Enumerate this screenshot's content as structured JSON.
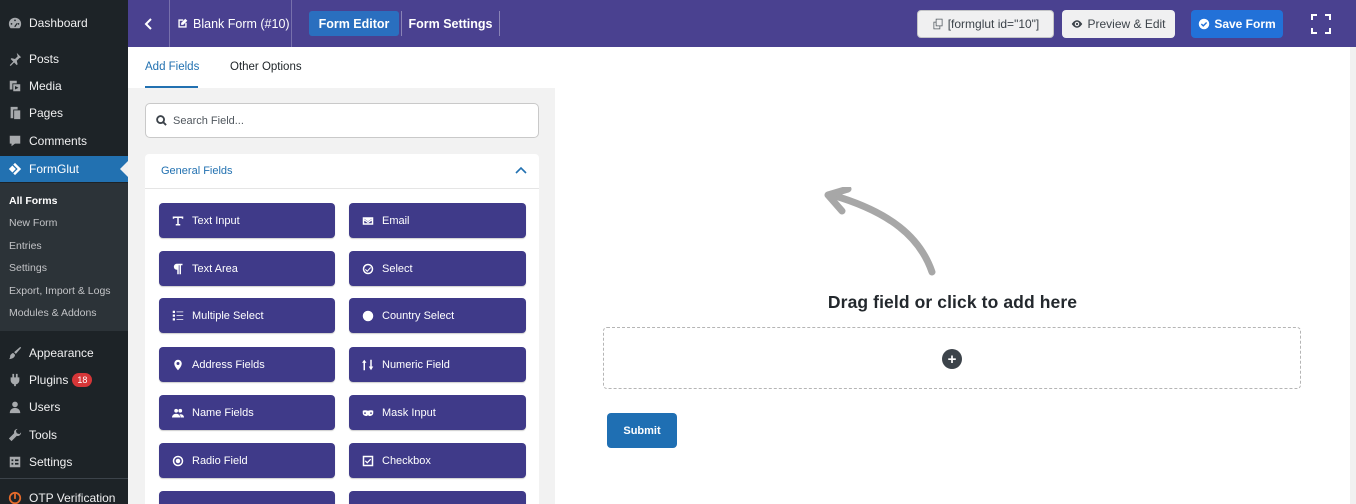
{
  "wp_menu": {
    "items": [
      {
        "label": "Dashboard",
        "icon": "dashboard-icon"
      },
      {
        "label": "Posts",
        "icon": "pin-icon"
      },
      {
        "label": "Media",
        "icon": "media-icon"
      },
      {
        "label": "Pages",
        "icon": "pages-icon"
      },
      {
        "label": "Comments",
        "icon": "comment-icon"
      },
      {
        "label": "FormGlut",
        "icon": "formglut-icon"
      },
      {
        "label": "Appearance",
        "icon": "brush-icon"
      },
      {
        "label": "Plugins",
        "icon": "plugin-icon",
        "badge": "18"
      },
      {
        "label": "Users",
        "icon": "user-icon"
      },
      {
        "label": "Tools",
        "icon": "wrench-icon"
      },
      {
        "label": "Settings",
        "icon": "settings-icon"
      },
      {
        "label": "OTP Verification",
        "icon": "otp-icon"
      }
    ],
    "submenu": [
      "All Forms",
      "New Form",
      "Entries",
      "Settings",
      "Export, Import & Logs",
      "Modules & Addons"
    ]
  },
  "toolbar": {
    "back_icon": "chevron-left-icon",
    "form_title": "Blank Form (#10)",
    "tab_editor": "Form Editor",
    "tab_settings": "Form Settings",
    "shortcode": "[formglut id=\"10\"]",
    "preview": "Preview & Edit",
    "save": "Save Form"
  },
  "panel": {
    "tab_add_fields": "Add Fields",
    "tab_other_options": "Other Options",
    "search_placeholder": "Search Field...",
    "section_title": "General Fields",
    "fields": [
      {
        "label": "Text Input",
        "icon": "text-input-icon"
      },
      {
        "label": "Email",
        "icon": "envelope-icon"
      },
      {
        "label": "Text Area",
        "icon": "paragraph-icon"
      },
      {
        "label": "Select",
        "icon": "check-circle-icon"
      },
      {
        "label": "Multiple Select",
        "icon": "list-icon"
      },
      {
        "label": "Country Select",
        "icon": "globe-icon"
      },
      {
        "label": "Address Fields",
        "icon": "map-pin-icon"
      },
      {
        "label": "Numeric Field",
        "icon": "sort-numeric-icon"
      },
      {
        "label": "Name Fields",
        "icon": "users-icon"
      },
      {
        "label": "Mask Input",
        "icon": "mask-icon"
      },
      {
        "label": "Radio Field",
        "icon": "radio-icon"
      },
      {
        "label": "Checkbox",
        "icon": "checkbox-icon"
      }
    ]
  },
  "canvas": {
    "drag_text": "Drag field or click to add here",
    "submit": "Submit"
  },
  "colors": {
    "toolbar_bg": "#4a4190",
    "field_button": "#3f3a89",
    "accent_blue": "#2271b1",
    "wp_sidebar": "#1d2327"
  }
}
